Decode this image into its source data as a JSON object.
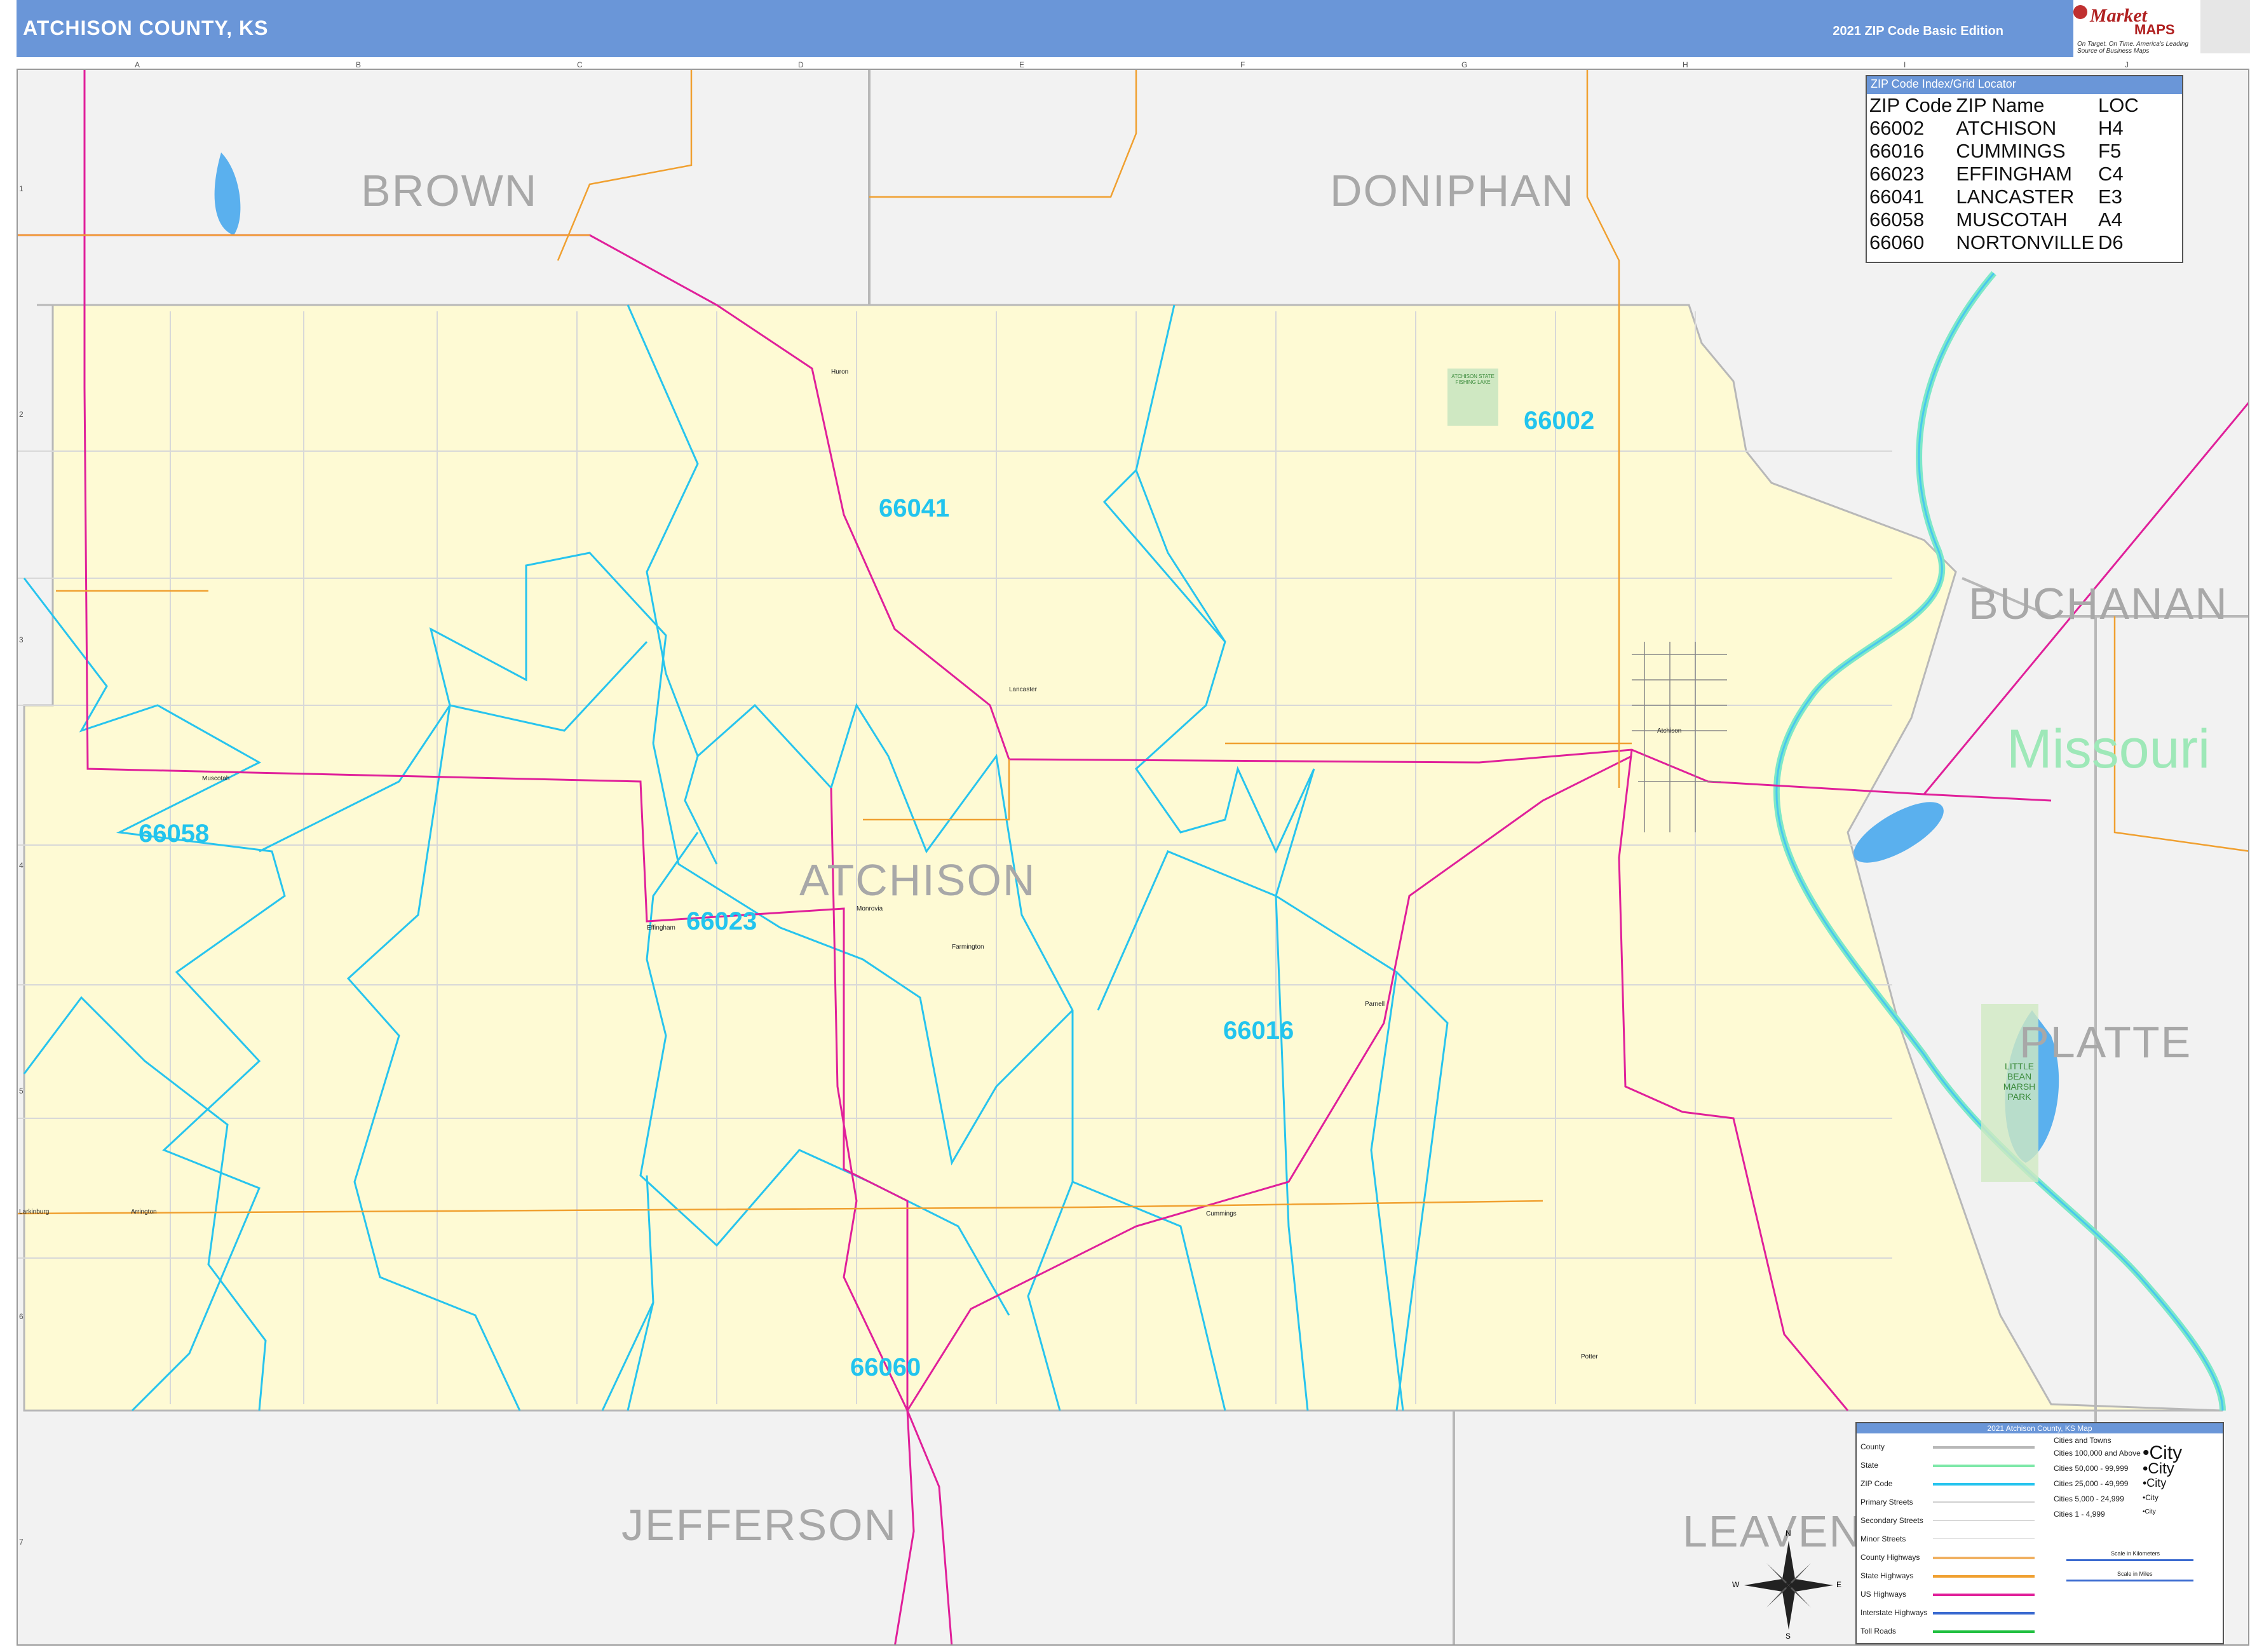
{
  "header": {
    "title": "ATCHISON COUNTY, KS",
    "edition": "2021 ZIP Code Basic Edition"
  },
  "logo": {
    "brand": "Market",
    "maps": "MAPS",
    "tagline": "On Target. On Time. America's Leading Source of Business Maps"
  },
  "counties": {
    "brown": "BROWN",
    "doniphan": "DONIPHAN",
    "atchison": "ATCHISON",
    "buchanan": "BUCHANAN",
    "platte": "PLATTE",
    "jefferson": "JEFFERSON",
    "leavenworth": "LEAVENW"
  },
  "state_label": "Missouri",
  "zip_labels": {
    "z66002": "66002",
    "z66041": "66041",
    "z66058": "66058",
    "z66023": "66023",
    "z66016": "66016",
    "z66060": "66060"
  },
  "towns": {
    "huron": "Huron",
    "lancaster": "Lancaster",
    "muscotah": "Muscotah",
    "effingham": "Effingham",
    "monrovia": "Monrovia",
    "farmington": "Farmington",
    "parnell": "Parnell",
    "atchison": "Atchison",
    "cummings": "Cummings",
    "potter": "Potter",
    "arrington": "Arrington",
    "larkinburg": "Larkinburg",
    "park1": "ATCHISON STATE FISHING LAKE",
    "park2": "LITTLE BEAN MARSH PARK"
  },
  "zip_index": {
    "header": "ZIP Code Index/Grid Locator",
    "columns": [
      "ZIP Code",
      "ZIP Name",
      "LOC"
    ],
    "rows": [
      [
        "66002",
        "ATCHISON",
        "H4"
      ],
      [
        "66016",
        "CUMMINGS",
        "F5"
      ],
      [
        "66023",
        "EFFINGHAM",
        "C4"
      ],
      [
        "66041",
        "LANCASTER",
        "E3"
      ],
      [
        "66058",
        "MUSCOTAH",
        "A4"
      ],
      [
        "66060",
        "NORTONVILLE",
        "D6"
      ]
    ]
  },
  "legend": {
    "header": "2021 Atchison County, KS Map",
    "items": [
      "County",
      "State",
      "ZIP Code",
      "Primary Streets",
      "Secondary Streets",
      "Minor Streets",
      "County Highways",
      "State Highways",
      "US Highways",
      "Interstate Highways",
      "Toll Roads"
    ],
    "city_items": [
      "Cities and Towns",
      "Cities 100,000 and Above",
      "Cities 50,000 - 99,999",
      "Cities 25,000 - 49,999",
      "Cities 5,000 - 24,999",
      "Cities 1 - 4,999"
    ],
    "city_samples": [
      "•City",
      "•City",
      "•City",
      "•City",
      "•City"
    ],
    "scale_km": "Scale in Kilometers",
    "scale_mi": "Scale in Miles",
    "colors": {
      "county": "#b8b8b8",
      "state": "#7de8a8",
      "zip": "#27c4ee",
      "county_hwy": "#f0b060",
      "state_hwy": "#f0a030",
      "us_hwy": "#e0209a",
      "interstate": "#3a6ad0",
      "toll": "#20c040"
    }
  },
  "compass": {
    "n": "N",
    "s": "S",
    "e": "E",
    "w": "W"
  },
  "grid": {
    "cols": [
      "A",
      "B",
      "C",
      "D",
      "E",
      "F",
      "G",
      "H",
      "I",
      "J"
    ],
    "rows": [
      "1",
      "2",
      "3",
      "4",
      "5",
      "6",
      "7"
    ]
  }
}
